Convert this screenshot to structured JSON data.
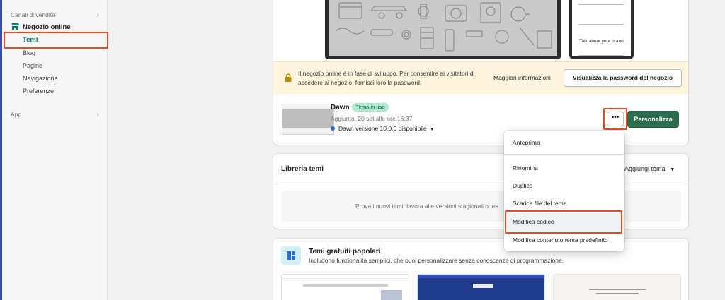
{
  "sidebar": {
    "sales_channels": "Canali di vendita",
    "store": "Negozio online",
    "items": [
      "Temi",
      "Blog",
      "Pagine",
      "Navigazione",
      "Preferenze"
    ],
    "apps": "App"
  },
  "preview": {
    "mobile_text": "Talk about your brand"
  },
  "banner": {
    "text": "Il negozio online è in fase di sviluppo. Per consentire ai visitatori di accedere al negozio, fornisci loro la password.",
    "more_info": "Maggiori informazioni",
    "password_button": "Visualizza la password del negozio"
  },
  "current_theme": {
    "name": "Dawn",
    "badge": "Tema in uso",
    "added": "Aggiunto: 20 set alle ore 16:37",
    "version": "Dawn versione 10.0.0 disponibile",
    "more_button": "•••",
    "customize": "Personalizza"
  },
  "menu": {
    "items": [
      "Anteprima",
      "Rinomina",
      "Duplica",
      "Scarica file del tema",
      "Modifica codice",
      "Modifica contenuto tema predefinito"
    ]
  },
  "library": {
    "title": "Libreria temi",
    "add": "Aggiungi tema",
    "empty": "Prova i nuovi temi, lavora alle versioni stagionali o tes"
  },
  "free_themes": {
    "title": "Temi gratuiti popolari",
    "subtitle": "Includono funzionalità semplici, che puoi personalizzare senza conoscenze di programmazione."
  },
  "colors": {
    "accent": "#2b6e4e",
    "highlight": "#e54d23",
    "badge_bg": "#aee9d1"
  }
}
